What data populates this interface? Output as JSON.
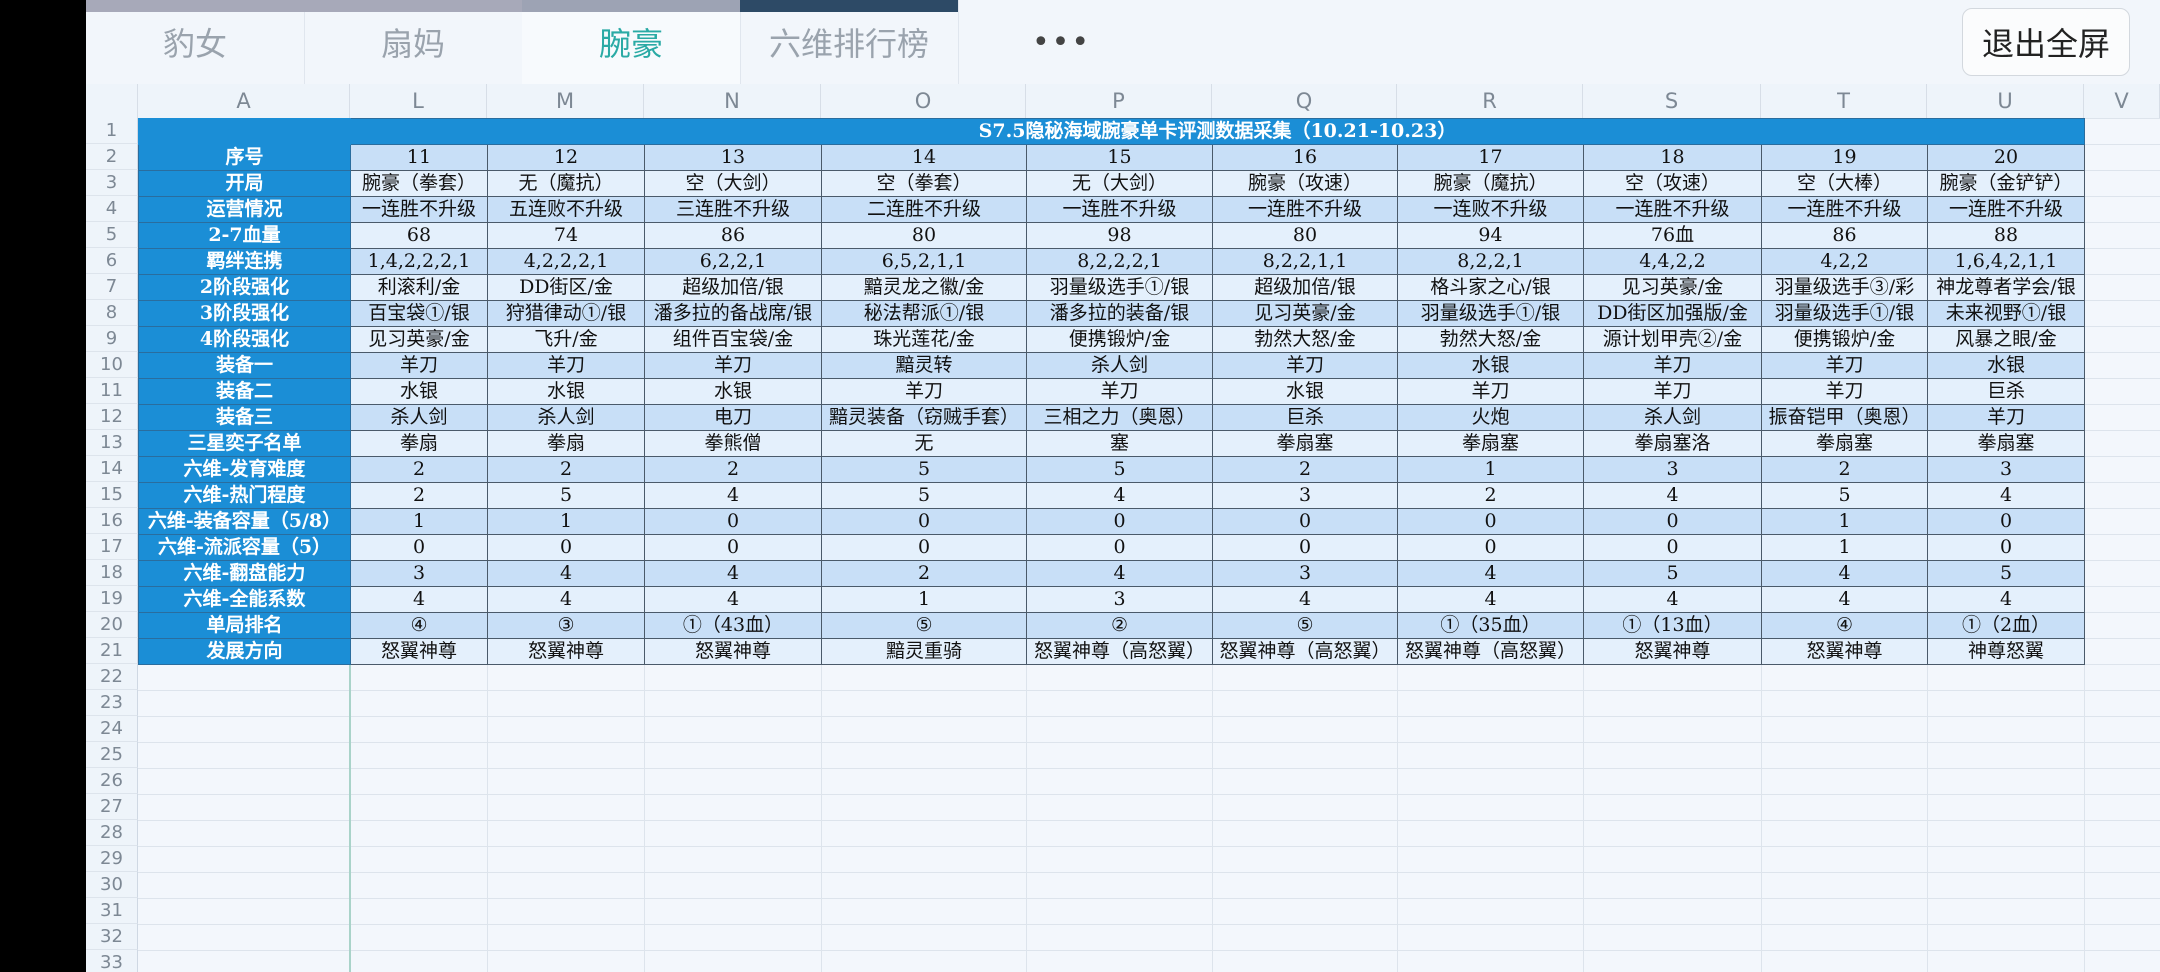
{
  "tabs": [
    {
      "label": "豹女"
    },
    {
      "label": "扇妈"
    },
    {
      "label": "腕豪"
    },
    {
      "label": "六维排行榜"
    }
  ],
  "more_label": "•••",
  "exit_button": "退出全屏",
  "colors": {
    "header_blue": "#1b8ed6",
    "row_dark": "#c8dff7",
    "row_light": "#e4f0fc",
    "active_tab": "#2aaaa5"
  },
  "column_letters": [
    "A",
    "L",
    "M",
    "N",
    "O",
    "P",
    "Q",
    "R",
    "S",
    "T",
    "U",
    "V"
  ],
  "row_numbers": [
    "1",
    "2",
    "3",
    "4",
    "5",
    "6",
    "7",
    "8",
    "9",
    "10",
    "11",
    "12",
    "13",
    "14",
    "15",
    "16",
    "17",
    "18",
    "19",
    "20",
    "21",
    "22",
    "23",
    "24",
    "25",
    "26",
    "27",
    "28",
    "29",
    "30",
    "31",
    "32",
    "33"
  ],
  "sheet": {
    "title": "S7.5隐秘海域腕豪单卡评测数据采集（10.21-10.23）",
    "labels": [
      "序号",
      "开局",
      "运营情况",
      "2-7血量",
      "羁绊连携",
      "2阶段强化",
      "3阶段强化",
      "4阶段强化",
      "装备一",
      "装备二",
      "装备三",
      "三星奕子名单",
      "六维-发育难度",
      "六维-热门程度",
      "六维-装备容量（5/8）",
      "六维-流派容量（5）",
      "六维-翻盘能力",
      "六维-全能系数",
      "单局排名",
      "发展方向"
    ],
    "rows": [
      [
        "11",
        "12",
        "13",
        "14",
        "15",
        "16",
        "17",
        "18",
        "19",
        "20"
      ],
      [
        "腕豪（拳套）",
        "无（魔抗）",
        "空（大剑）",
        "空（拳套）",
        "无（大剑）",
        "腕豪（攻速）",
        "腕豪（魔抗）",
        "空（攻速）",
        "空（大棒）",
        "腕豪（金铲铲）"
      ],
      [
        "一连胜不升级",
        "五连败不升级",
        "三连胜不升级",
        "二连胜不升级",
        "一连胜不升级",
        "一连胜不升级",
        "一连败不升级",
        "一连胜不升级",
        "一连胜不升级",
        "一连胜不升级"
      ],
      [
        "68",
        "74",
        "86",
        "80",
        "98",
        "80",
        "94",
        "76血",
        "86",
        "88"
      ],
      [
        "1,4,2,2,2,1",
        "4,2,2,2,1",
        "6,2,2,1",
        "6,5,2,1,1",
        "8,2,2,2,1",
        "8,2,2,1,1",
        "8,2,2,1",
        "4,4,2,2",
        "4,2,2",
        "1,6,4,2,1,1"
      ],
      [
        "利滚利/金",
        "DD街区/金",
        "超级加倍/银",
        "黯灵龙之徽/金",
        "羽量级选手①/银",
        "超级加倍/银",
        "格斗家之心/银",
        "见习英豪/金",
        "羽量级选手③/彩",
        "神龙尊者学会/银"
      ],
      [
        "百宝袋①/银",
        "狩猎律动①/银",
        "潘多拉的备战席/银",
        "秘法帮派①/银",
        "潘多拉的装备/银",
        "见习英豪/金",
        "羽量级选手①/银",
        "DD街区加强版/金",
        "羽量级选手①/银",
        "未来视野①/银"
      ],
      [
        "见习英豪/金",
        "飞升/金",
        "组件百宝袋/金",
        "珠光莲花/金",
        "便携锻炉/金",
        "勃然大怒/金",
        "勃然大怒/金",
        "源计划甲壳②/金",
        "便携锻炉/金",
        "风暴之眼/金"
      ],
      [
        "羊刀",
        "羊刀",
        "羊刀",
        "黯灵转",
        "杀人剑",
        "羊刀",
        "水银",
        "羊刀",
        "羊刀",
        "水银"
      ],
      [
        "水银",
        "水银",
        "水银",
        "羊刀",
        "羊刀",
        "水银",
        "羊刀",
        "羊刀",
        "羊刀",
        "巨杀"
      ],
      [
        "杀人剑",
        "杀人剑",
        "电刀",
        "黯灵装备（窃贼手套）",
        "三相之力（奥恩）",
        "巨杀",
        "火炮",
        "杀人剑",
        "振奋铠甲（奥恩）",
        "羊刀"
      ],
      [
        "拳扇",
        "拳扇",
        "拳熊僧",
        "无",
        "塞",
        "拳扇塞",
        "拳扇塞",
        "拳扇塞洛",
        "拳扇塞",
        "拳扇塞"
      ],
      [
        "2",
        "2",
        "2",
        "5",
        "5",
        "2",
        "1",
        "3",
        "2",
        "3"
      ],
      [
        "2",
        "5",
        "4",
        "5",
        "4",
        "3",
        "2",
        "4",
        "5",
        "4"
      ],
      [
        "1",
        "1",
        "0",
        "0",
        "0",
        "0",
        "0",
        "0",
        "1",
        "0"
      ],
      [
        "0",
        "0",
        "0",
        "0",
        "0",
        "0",
        "0",
        "0",
        "1",
        "0"
      ],
      [
        "3",
        "4",
        "4",
        "2",
        "4",
        "3",
        "4",
        "5",
        "4",
        "5"
      ],
      [
        "4",
        "4",
        "4",
        "1",
        "3",
        "4",
        "4",
        "4",
        "4",
        "4"
      ],
      [
        "④",
        "③",
        "①（43血）",
        "⑤",
        "②",
        "⑤",
        "①（35血）",
        "①（13血）",
        "④",
        "①（2血）"
      ],
      [
        "怒翼神尊",
        "怒翼神尊",
        "怒翼神尊",
        "黯灵重骑",
        "怒翼神尊（高怒翼）",
        "怒翼神尊（高怒翼）",
        "怒翼神尊（高怒翼）",
        "怒翼神尊",
        "怒翼神尊",
        "神尊怒翼"
      ]
    ]
  }
}
